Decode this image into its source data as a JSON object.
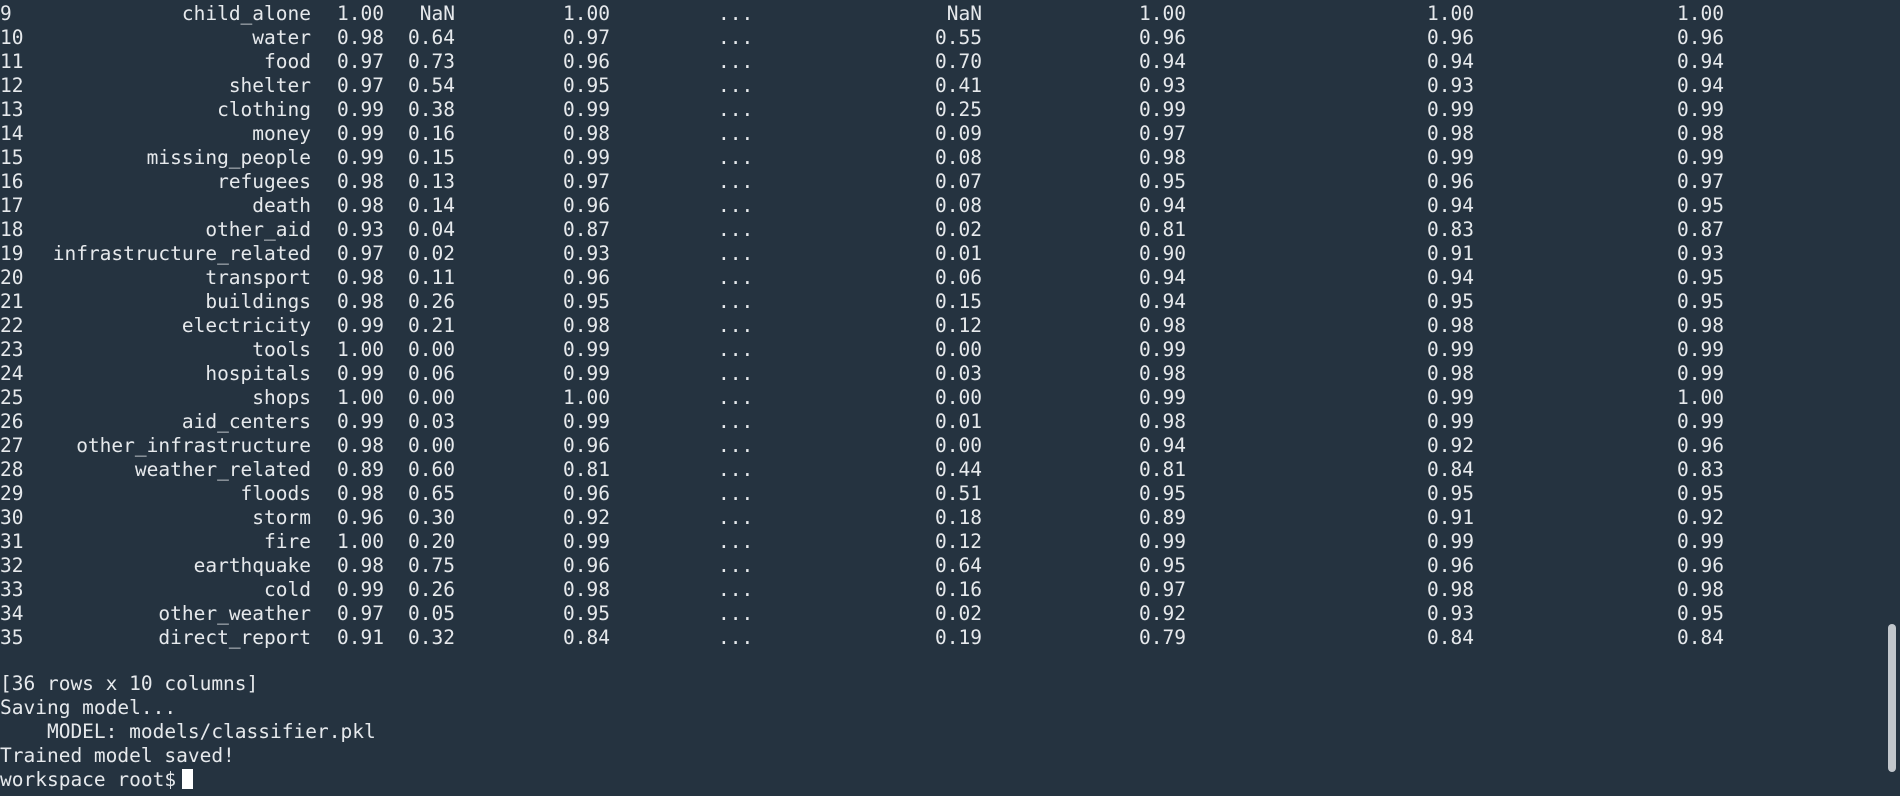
{
  "table": {
    "rows": [
      {
        "idx": "9",
        "name": "child_alone",
        "c1": "1.00",
        "c2": "NaN",
        "c3": "1.00",
        "c4": "...",
        "c5": "NaN",
        "c6": "1.00",
        "c7": "1.00",
        "c8": "1.00"
      },
      {
        "idx": "10",
        "name": "water",
        "c1": "0.98",
        "c2": "0.64",
        "c3": "0.97",
        "c4": "...",
        "c5": "0.55",
        "c6": "0.96",
        "c7": "0.96",
        "c8": "0.96"
      },
      {
        "idx": "11",
        "name": "food",
        "c1": "0.97",
        "c2": "0.73",
        "c3": "0.96",
        "c4": "...",
        "c5": "0.70",
        "c6": "0.94",
        "c7": "0.94",
        "c8": "0.94"
      },
      {
        "idx": "12",
        "name": "shelter",
        "c1": "0.97",
        "c2": "0.54",
        "c3": "0.95",
        "c4": "...",
        "c5": "0.41",
        "c6": "0.93",
        "c7": "0.93",
        "c8": "0.94"
      },
      {
        "idx": "13",
        "name": "clothing",
        "c1": "0.99",
        "c2": "0.38",
        "c3": "0.99",
        "c4": "...",
        "c5": "0.25",
        "c6": "0.99",
        "c7": "0.99",
        "c8": "0.99"
      },
      {
        "idx": "14",
        "name": "money",
        "c1": "0.99",
        "c2": "0.16",
        "c3": "0.98",
        "c4": "...",
        "c5": "0.09",
        "c6": "0.97",
        "c7": "0.98",
        "c8": "0.98"
      },
      {
        "idx": "15",
        "name": "missing_people",
        "c1": "0.99",
        "c2": "0.15",
        "c3": "0.99",
        "c4": "...",
        "c5": "0.08",
        "c6": "0.98",
        "c7": "0.99",
        "c8": "0.99"
      },
      {
        "idx": "16",
        "name": "refugees",
        "c1": "0.98",
        "c2": "0.13",
        "c3": "0.97",
        "c4": "...",
        "c5": "0.07",
        "c6": "0.95",
        "c7": "0.96",
        "c8": "0.97"
      },
      {
        "idx": "17",
        "name": "death",
        "c1": "0.98",
        "c2": "0.14",
        "c3": "0.96",
        "c4": "...",
        "c5": "0.08",
        "c6": "0.94",
        "c7": "0.94",
        "c8": "0.95"
      },
      {
        "idx": "18",
        "name": "other_aid",
        "c1": "0.93",
        "c2": "0.04",
        "c3": "0.87",
        "c4": "...",
        "c5": "0.02",
        "c6": "0.81",
        "c7": "0.83",
        "c8": "0.87"
      },
      {
        "idx": "19",
        "name": "infrastructure_related",
        "c1": "0.97",
        "c2": "0.02",
        "c3": "0.93",
        "c4": "...",
        "c5": "0.01",
        "c6": "0.90",
        "c7": "0.91",
        "c8": "0.93"
      },
      {
        "idx": "20",
        "name": "transport",
        "c1": "0.98",
        "c2": "0.11",
        "c3": "0.96",
        "c4": "...",
        "c5": "0.06",
        "c6": "0.94",
        "c7": "0.94",
        "c8": "0.95"
      },
      {
        "idx": "21",
        "name": "buildings",
        "c1": "0.98",
        "c2": "0.26",
        "c3": "0.95",
        "c4": "...",
        "c5": "0.15",
        "c6": "0.94",
        "c7": "0.95",
        "c8": "0.95"
      },
      {
        "idx": "22",
        "name": "electricity",
        "c1": "0.99",
        "c2": "0.21",
        "c3": "0.98",
        "c4": "...",
        "c5": "0.12",
        "c6": "0.98",
        "c7": "0.98",
        "c8": "0.98"
      },
      {
        "idx": "23",
        "name": "tools",
        "c1": "1.00",
        "c2": "0.00",
        "c3": "0.99",
        "c4": "...",
        "c5": "0.00",
        "c6": "0.99",
        "c7": "0.99",
        "c8": "0.99"
      },
      {
        "idx": "24",
        "name": "hospitals",
        "c1": "0.99",
        "c2": "0.06",
        "c3": "0.99",
        "c4": "...",
        "c5": "0.03",
        "c6": "0.98",
        "c7": "0.98",
        "c8": "0.99"
      },
      {
        "idx": "25",
        "name": "shops",
        "c1": "1.00",
        "c2": "0.00",
        "c3": "1.00",
        "c4": "...",
        "c5": "0.00",
        "c6": "0.99",
        "c7": "0.99",
        "c8": "1.00"
      },
      {
        "idx": "26",
        "name": "aid_centers",
        "c1": "0.99",
        "c2": "0.03",
        "c3": "0.99",
        "c4": "...",
        "c5": "0.01",
        "c6": "0.98",
        "c7": "0.99",
        "c8": "0.99"
      },
      {
        "idx": "27",
        "name": "other_infrastructure",
        "c1": "0.98",
        "c2": "0.00",
        "c3": "0.96",
        "c4": "...",
        "c5": "0.00",
        "c6": "0.94",
        "c7": "0.92",
        "c8": "0.96"
      },
      {
        "idx": "28",
        "name": "weather_related",
        "c1": "0.89",
        "c2": "0.60",
        "c3": "0.81",
        "c4": "...",
        "c5": "0.44",
        "c6": "0.81",
        "c7": "0.84",
        "c8": "0.83"
      },
      {
        "idx": "29",
        "name": "floods",
        "c1": "0.98",
        "c2": "0.65",
        "c3": "0.96",
        "c4": "...",
        "c5": "0.51",
        "c6": "0.95",
        "c7": "0.95",
        "c8": "0.95"
      },
      {
        "idx": "30",
        "name": "storm",
        "c1": "0.96",
        "c2": "0.30",
        "c3": "0.92",
        "c4": "...",
        "c5": "0.18",
        "c6": "0.89",
        "c7": "0.91",
        "c8": "0.92"
      },
      {
        "idx": "31",
        "name": "fire",
        "c1": "1.00",
        "c2": "0.20",
        "c3": "0.99",
        "c4": "...",
        "c5": "0.12",
        "c6": "0.99",
        "c7": "0.99",
        "c8": "0.99"
      },
      {
        "idx": "32",
        "name": "earthquake",
        "c1": "0.98",
        "c2": "0.75",
        "c3": "0.96",
        "c4": "...",
        "c5": "0.64",
        "c6": "0.95",
        "c7": "0.96",
        "c8": "0.96"
      },
      {
        "idx": "33",
        "name": "cold",
        "c1": "0.99",
        "c2": "0.26",
        "c3": "0.98",
        "c4": "...",
        "c5": "0.16",
        "c6": "0.97",
        "c7": "0.98",
        "c8": "0.98"
      },
      {
        "idx": "34",
        "name": "other_weather",
        "c1": "0.97",
        "c2": "0.05",
        "c3": "0.95",
        "c4": "...",
        "c5": "0.02",
        "c6": "0.92",
        "c7": "0.93",
        "c8": "0.95"
      },
      {
        "idx": "35",
        "name": "direct_report",
        "c1": "0.91",
        "c2": "0.32",
        "c3": "0.84",
        "c4": "...",
        "c5": "0.19",
        "c6": "0.79",
        "c7": "0.84",
        "c8": "0.84"
      }
    ]
  },
  "output": {
    "summary": "[36 rows x 10 columns]",
    "saving": "Saving model...",
    "model_path": "    MODEL: models/classifier.pkl",
    "saved": "Trained model saved!",
    "prompt": "workspace root$"
  },
  "colors": {
    "background": "#253340",
    "text": "#e6e9ec",
    "cursor": "#ffffff",
    "scrollbar_thumb": "#c2c7cc"
  }
}
